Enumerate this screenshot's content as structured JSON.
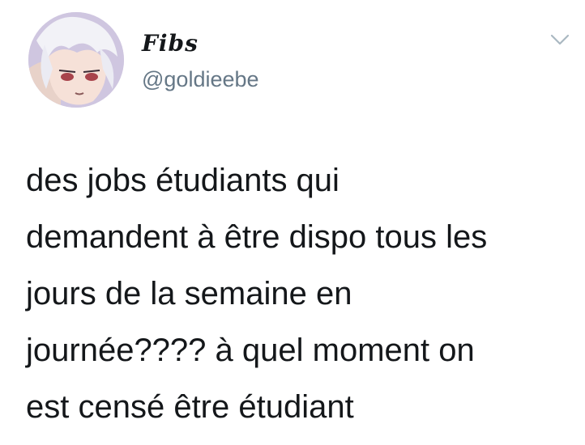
{
  "tweet": {
    "author": {
      "display_name": "Fibs",
      "handle": "@goldieebe"
    },
    "text": "des jobs étudiants qui\ndemandent à être dispo tous les\njours de la semaine en\njournée???? à quel moment on\nest censé être étudiant"
  },
  "icons": {
    "avatar": "avatar-anime-character",
    "menu": "chevron-down-icon"
  },
  "colors": {
    "text": "#14171a",
    "handle": "#657786",
    "caret": "#aab8c2",
    "background": "#ffffff"
  }
}
